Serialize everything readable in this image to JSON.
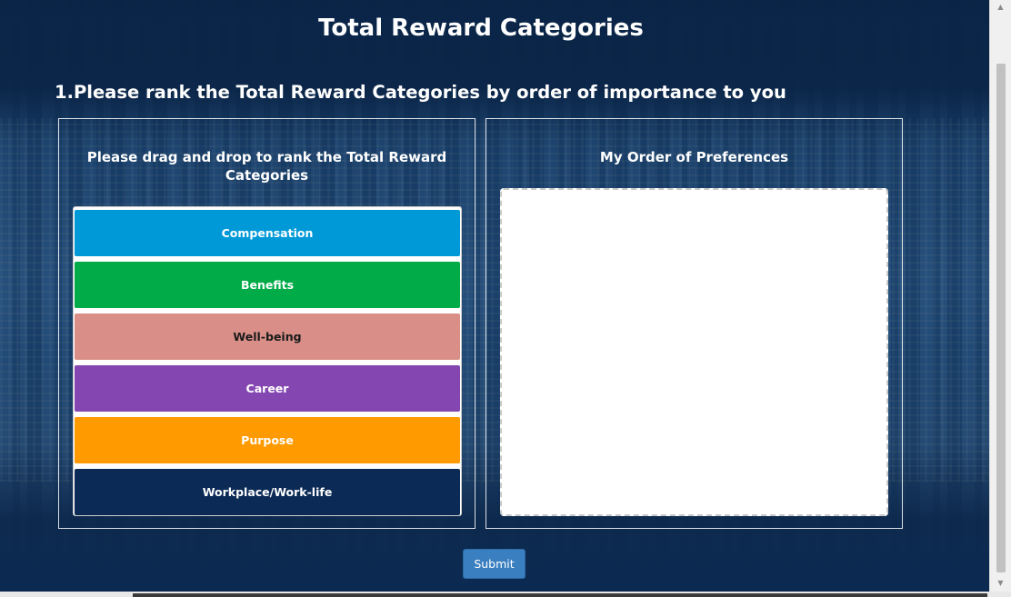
{
  "header": {
    "title": "Total Reward Categories"
  },
  "question": {
    "text": "1.Please rank the Total Reward Categories by order of importance to you"
  },
  "left_panel": {
    "heading": "Please drag and drop to rank the Total Reward Categories",
    "items": [
      {
        "label": "Compensation",
        "color": "#0099d8",
        "text_color": "#ffffff"
      },
      {
        "label": "Benefits",
        "color": "#00ab48",
        "text_color": "#ffffff"
      },
      {
        "label": "Well-being",
        "color": "#d98f88",
        "text_color": "#1a1a1a"
      },
      {
        "label": "Career",
        "color": "#8447b1",
        "text_color": "#ffffff"
      },
      {
        "label": "Purpose",
        "color": "#ff9a00",
        "text_color": "#ffffff"
      },
      {
        "label": "Workplace/Work-life",
        "color": "#0b2a55",
        "text_color": "#ffffff"
      }
    ]
  },
  "right_panel": {
    "heading": "My Order of Preferences"
  },
  "actions": {
    "submit_label": "Submit"
  },
  "colors": {
    "accent": "#3a7fc0",
    "background": "#0d2f55"
  },
  "scrollbar": {
    "up_icon": "triangle-up",
    "down_icon": "triangle-down"
  }
}
